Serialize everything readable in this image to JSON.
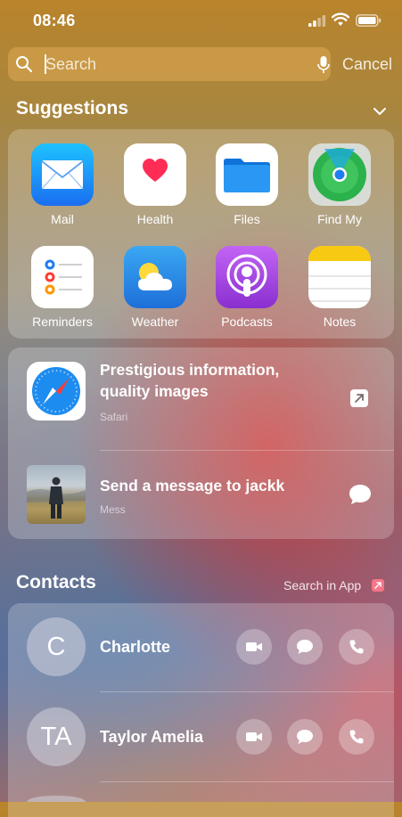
{
  "status_bar": {
    "time": "08:46"
  },
  "search": {
    "placeholder": "Search",
    "cancel_label": "Cancel"
  },
  "suggestions": {
    "title": "Suggestions",
    "apps": [
      {
        "label": "Mail",
        "icon": "mail-icon"
      },
      {
        "label": "Health",
        "icon": "health-icon"
      },
      {
        "label": "Files",
        "icon": "files-icon"
      },
      {
        "label": "Find My",
        "icon": "find-my-icon"
      },
      {
        "label": "Reminders",
        "icon": "reminders-icon"
      },
      {
        "label": "Weather",
        "icon": "weather-icon"
      },
      {
        "label": "Podcasts",
        "icon": "podcasts-icon"
      },
      {
        "label": "Notes",
        "icon": "notes-icon"
      }
    ],
    "siri_suggestions": [
      {
        "title": "Prestigious information, quality images",
        "source": "Safari",
        "icon": "safari-icon",
        "action_icon": "open-link-icon"
      },
      {
        "title": "Send a message to jackk",
        "source": "Mess",
        "icon": "photo-thumbnail",
        "action_icon": "message-bubble-icon"
      }
    ]
  },
  "contacts": {
    "title": "Contacts",
    "search_in_app": "Search in App",
    "items": [
      {
        "initials": "C",
        "name": "Charlotte"
      },
      {
        "initials": "TA",
        "name": "Taylor Amelia"
      }
    ]
  },
  "colors": {
    "mail": "#2c8df5",
    "health": "#ff2d55",
    "files": "#1e8df2",
    "podcasts": "#9a3fd6",
    "notes_top": "#f6c80e"
  }
}
